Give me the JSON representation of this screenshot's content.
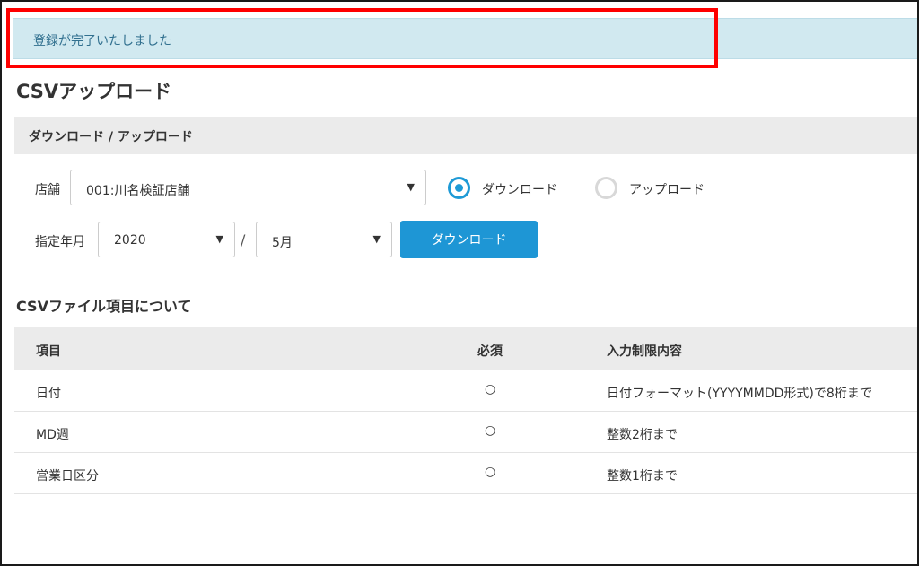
{
  "alert": {
    "message": "登録が完了いたしました"
  },
  "page": {
    "title": "CSVアップロード"
  },
  "section": {
    "title": "ダウンロード / アップロード"
  },
  "form": {
    "store_label": "店舗",
    "store_value": "001:川名検証店舗",
    "mode_options": [
      {
        "label": "ダウンロード",
        "selected": true
      },
      {
        "label": "アップロード",
        "selected": false
      }
    ],
    "date_label": "指定年月",
    "year_value": "2020",
    "separator": "/",
    "month_value": "5月",
    "download_button": "ダウンロード",
    "caret": "▼"
  },
  "csv_info": {
    "title": "CSVファイル項目について",
    "headers": [
      "項目",
      "必須",
      "入力制限内容"
    ],
    "rows": [
      {
        "item": "日付",
        "required": "○",
        "constraint": "日付フォーマット(YYYYMMDD形式)で8桁まで"
      },
      {
        "item": "MD週",
        "required": "○",
        "constraint": "整数2桁まで"
      },
      {
        "item": "営業日区分",
        "required": "○",
        "constraint": "整数1桁まで"
      }
    ]
  },
  "colors": {
    "accent": "#1e96d5",
    "alert_bg": "#d1e9f0",
    "highlight": "#ff0000"
  }
}
